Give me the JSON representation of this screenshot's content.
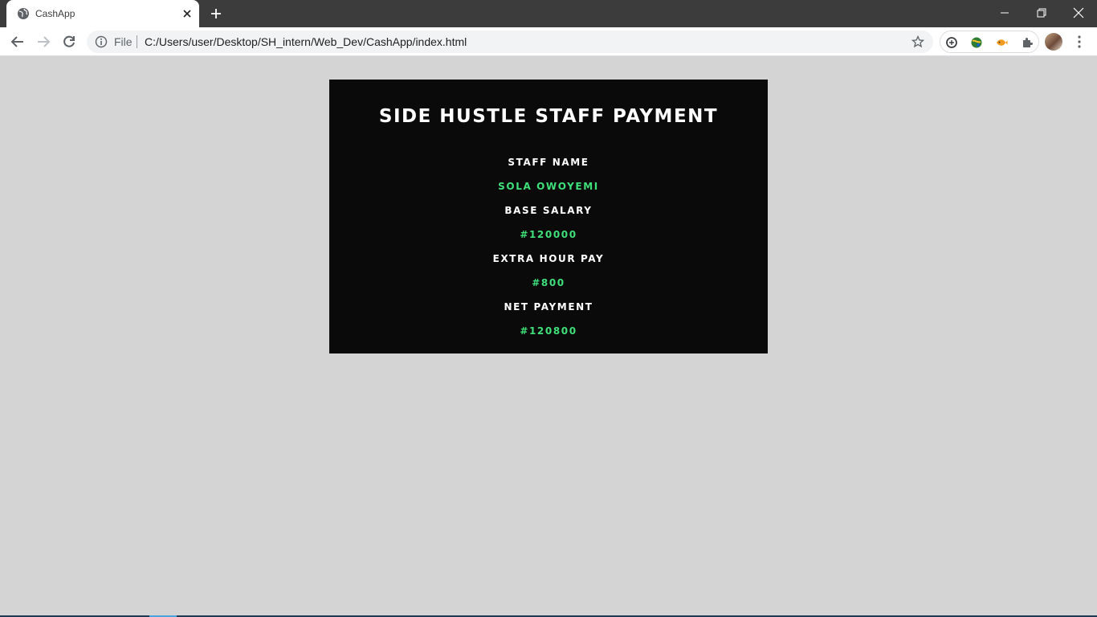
{
  "browser": {
    "tab_title": "CashApp",
    "scheme_label": "File",
    "url": "C:/Users/user/Desktop/SH_intern/Web_Dev/CashApp/index.html"
  },
  "page": {
    "heading": "SIDE HUSTLE STAFF PAYMENT",
    "fields": [
      {
        "label": "STAFF NAME",
        "value": "SOLA OWOYEMI"
      },
      {
        "label": "BASE SALARY",
        "value": "#120000"
      },
      {
        "label": "EXTRA HOUR PAY",
        "value": "#800"
      },
      {
        "label": "NET PAYMENT",
        "value": "#120800"
      }
    ]
  },
  "colors": {
    "page_background": "#d4d4d4",
    "card_background": "#0a0a0a",
    "label_text": "#ffffff",
    "value_text": "#3fe07a"
  }
}
